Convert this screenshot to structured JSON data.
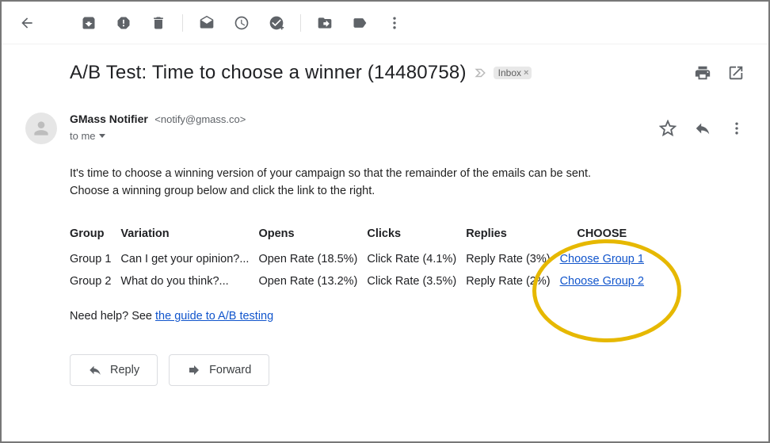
{
  "header": {
    "subject": "A/B Test: Time to choose a winner (14480758)",
    "label": "Inbox"
  },
  "sender": {
    "name": "GMass Notifier",
    "email": "<notify@gmass.co>",
    "to_text": "to me"
  },
  "body": {
    "line1": "It's time to choose a winning version of your campaign so that the remainder of the emails can be sent.",
    "line2": "Choose a winning group below and click the link to the right."
  },
  "table": {
    "headers": {
      "group": "Group",
      "variation": "Variation",
      "opens": "Opens",
      "clicks": "Clicks",
      "replies": "Replies",
      "choose": "CHOOSE"
    },
    "rows": [
      {
        "group": "Group 1",
        "variation": "Can I get your opinion?...",
        "opens": "Open Rate (18.5%)",
        "clicks": "Click Rate (4.1%)",
        "replies": "Reply Rate (3%)",
        "choose": "Choose Group 1"
      },
      {
        "group": "Group 2",
        "variation": "What do you think?...",
        "opens": "Open Rate (13.2%)",
        "clicks": "Click Rate (3.5%)",
        "replies": "Reply Rate (2%)",
        "choose": "Choose Group 2"
      }
    ]
  },
  "help": {
    "prefix": "Need help? See ",
    "link_text": "the guide to A/B testing"
  },
  "buttons": {
    "reply": "Reply",
    "forward": "Forward"
  }
}
